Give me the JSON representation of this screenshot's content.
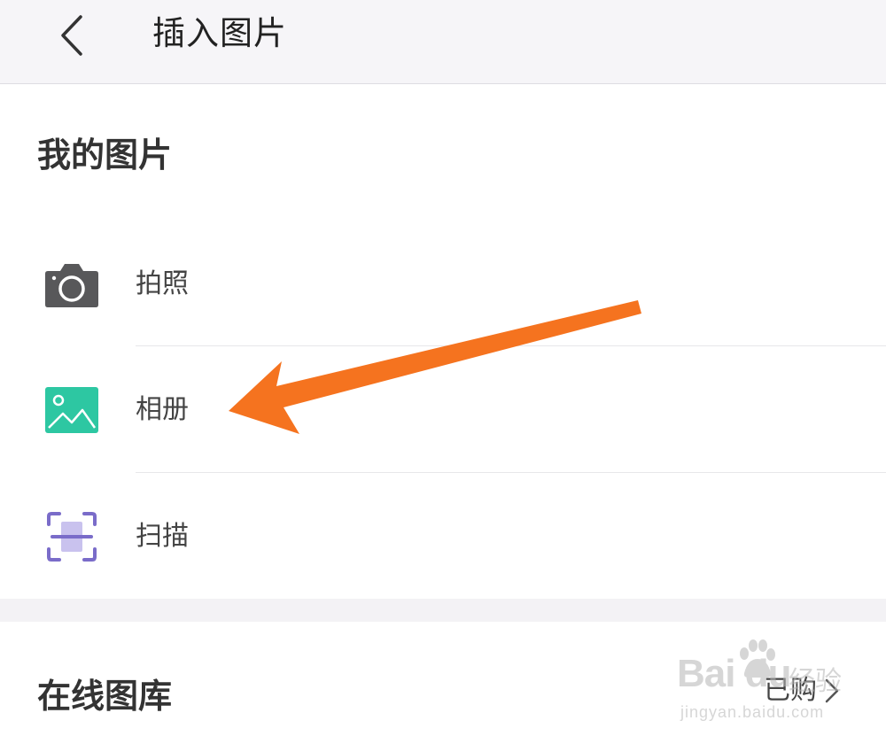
{
  "header": {
    "title": "插入图片",
    "back_icon": "chevron-left-icon"
  },
  "my_images": {
    "title": "我的图片",
    "items": [
      {
        "label": "拍照",
        "icon": "camera-icon",
        "color": "#58585a"
      },
      {
        "label": "相册",
        "icon": "image-icon",
        "color": "#2dc7a2"
      },
      {
        "label": "扫描",
        "icon": "scan-icon",
        "color": "#7a6cc9"
      }
    ]
  },
  "online_gallery": {
    "title": "在线图库",
    "purchased_label": "已购",
    "purchased_icon": "chevron-right-icon"
  },
  "watermark": {
    "brand": "Bai du",
    "brand_cn": "经验",
    "url": "jingyan.baidu.com"
  },
  "annotation": {
    "arrow_color": "#f5731f"
  }
}
